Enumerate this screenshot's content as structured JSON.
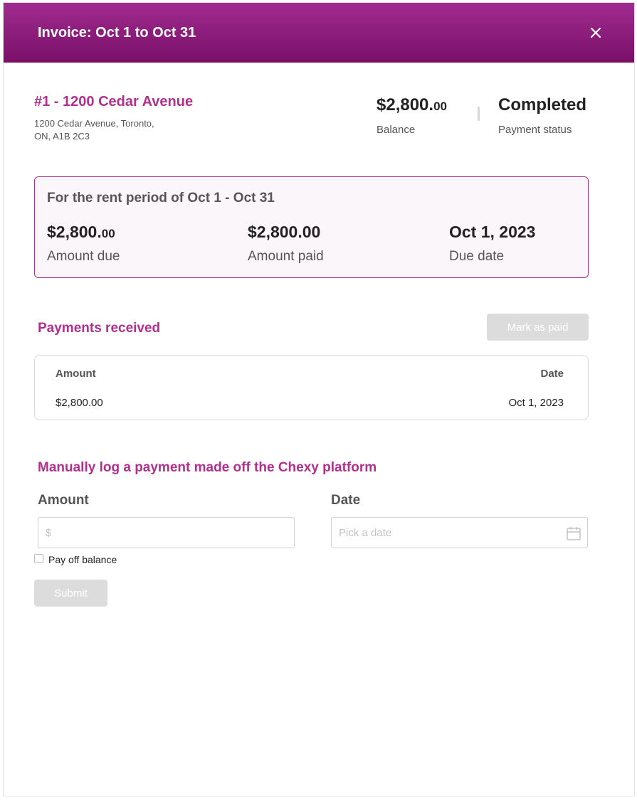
{
  "header": {
    "title": "Invoice: Oct 1 to Oct 31",
    "close_icon": "close-icon"
  },
  "property": {
    "name": "#1 - 1200 Cedar Avenue",
    "address_line1": "1200 Cedar Avenue, Toronto,",
    "address_line2": "ON, A1B 2C3"
  },
  "summary": {
    "balance_dollars": "$2,800.",
    "balance_cents": "00",
    "balance_label": "Balance",
    "status_value": "Completed",
    "status_label": "Payment status"
  },
  "period": {
    "title": "For the rent period of Oct 1 - Oct 31",
    "amount_due_dollars": "$2,800.",
    "amount_due_cents": "00",
    "amount_due_label": "Amount due",
    "amount_paid": "$2,800.00",
    "amount_paid_label": "Amount paid",
    "due_date": "Oct 1, 2023",
    "due_date_label": "Due date"
  },
  "payments": {
    "title": "Payments received",
    "mark_paid_label": "Mark as paid",
    "columns": [
      "Amount",
      "Date"
    ],
    "rows": [
      {
        "amount": "$2,800.00",
        "date": "Oct 1, 2023"
      }
    ]
  },
  "manual_log": {
    "title": "Manually log a payment made off the Chexy platform",
    "amount_label": "Amount",
    "amount_placeholder": "$",
    "date_label": "Date",
    "date_placeholder": "Pick a date",
    "pay_off_label": "Pay off balance",
    "submit_label": "Submit"
  },
  "colors": {
    "accent": "#b1308f",
    "header_top": "#a02c90",
    "header_bottom": "#7a0f68",
    "disabled_button": "#dcdcdc"
  }
}
